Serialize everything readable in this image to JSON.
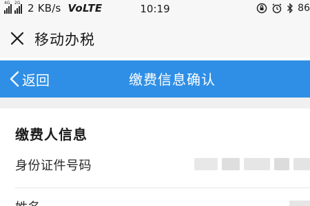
{
  "status_bar": {
    "network_tag": "4G",
    "network_tag_2": "2G",
    "speed": "2 KB/s",
    "volte": "VoLTE",
    "time": "10:19",
    "battery": "86"
  },
  "app_bar": {
    "close_icon": "close-icon",
    "title": "移动办税"
  },
  "nav_bar": {
    "back_label": "返回",
    "title": "缴费信息确认",
    "color": "#2f8fe6"
  },
  "payer_info": {
    "section_title": "缴费人信息",
    "id_label": "身份证件号码",
    "name_label": "姓名"
  }
}
